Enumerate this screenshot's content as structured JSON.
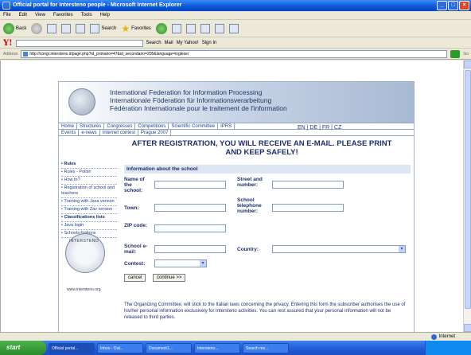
{
  "window": {
    "title": "Official portal for Intersteno people - Microsoft Internet Explorer",
    "controls": [
      "_",
      "□",
      "×"
    ]
  },
  "menu": [
    "File",
    "Edit",
    "View",
    "Favorites",
    "Tools",
    "Help"
  ],
  "toolbar": {
    "back": "Back",
    "search": "Search",
    "favorites": "Favorites"
  },
  "yahoo": {
    "logo": "Y!",
    "search": "Search",
    "mail": "Mail",
    "my_yahoo": "My Yahoo!",
    "signin": "Sign In"
  },
  "address": {
    "label": "Address",
    "url": "http://congr.intersteno.it/page.php?id_primario=47&id_secondario=205&language=inglese/",
    "go": "Go"
  },
  "banner": {
    "line1": "International Federation for Information Processing",
    "line2": "Internationale Föderation für Informationsverarbeitung",
    "line3": "Fédération Internationale pour le traitement de l'information"
  },
  "nav": {
    "row1": [
      "Home",
      "Structures",
      "Congresses",
      "Competitions",
      "Scientific Committee",
      "IPRS"
    ],
    "row2": [
      "Events",
      "e-news",
      "Internet contest",
      "Prague 2007"
    ],
    "langs": "EN | DE | FR | CZ"
  },
  "notice": "AFTER REGISTRATION, YOU WILL RECEIVE AN E-MAIL. PLEASE PRINT AND KEEP SAFELY!",
  "sidebar": {
    "items": [
      {
        "label": "Rules",
        "bold": true
      },
      {
        "label": "Rules - Polish",
        "bold": false
      },
      {
        "label": "How to?",
        "bold": false
      },
      {
        "label": "Registration of school and teachers",
        "bold": false
      },
      {
        "label": "Training with Java version",
        "bold": false
      },
      {
        "label": "Training with Zav version",
        "bold": false
      },
      {
        "label": "Classifications lists",
        "bold": true
      },
      {
        "label": "Java login",
        "bold": false
      },
      {
        "label": "Schools-Nations",
        "bold": false
      }
    ],
    "emblem_url": "www.intersteno.org"
  },
  "form": {
    "header": "Information about the school",
    "school_name_label": "Name of the school:",
    "street_label": "Street and number:",
    "town_label": "Town:",
    "phone_label": "School telephone number:",
    "zip_label": "ZIP code:",
    "email_label": "School e-mail:",
    "country_label": "Country:",
    "contest_label": "Contest:",
    "cancel_label": "cancel",
    "continue_label": "continue >>",
    "privacy": "The Organizing Committee, will stick to the Italian laws concerning the privacy. Entering this form the subscriber authorises the use of his/her personal information exclusively for Intersteno activities. You can rest assured that your personal information will not be released to third parties."
  },
  "status": {
    "zone": "Internet"
  },
  "taskbar": {
    "start": "start",
    "tasks": [
      "Official portal...",
      "Inbox - Out...",
      "Document1...",
      "Intersteno...",
      "Search res..."
    ]
  }
}
